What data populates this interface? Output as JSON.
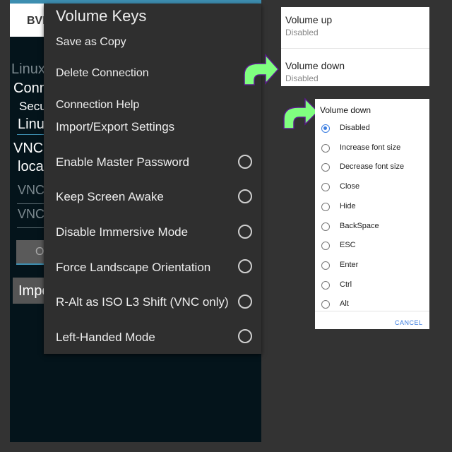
{
  "background_app": {
    "header_label": "BVN",
    "texts": [
      "Linux",
      "Conn",
      "Secu",
      "Linu",
      "VNC",
      "loca",
      "VNC",
      "VNC"
    ],
    "button1": "OI",
    "button2": "Impo"
  },
  "menu": {
    "title": "Volume Keys",
    "items": [
      {
        "label": "Save as Copy"
      },
      {
        "label": "Delete Connection"
      },
      {
        "label": "Connection Help"
      },
      {
        "label": "Import/Export Settings"
      },
      {
        "label": "Enable Master Password",
        "checked": false
      },
      {
        "label": "Keep Screen Awake",
        "checked": false
      },
      {
        "label": "Disable Immersive Mode",
        "checked": false
      },
      {
        "label": "Force Landscape Orientation",
        "checked": false
      },
      {
        "label": "R-Alt as ISO L3 Shift (VNC only)",
        "checked": false
      },
      {
        "label": "Left-Handed Mode",
        "checked": false
      }
    ]
  },
  "volume_keys": [
    {
      "title": "Volume up",
      "value": "Disabled"
    },
    {
      "title": "Volume down",
      "value": "Disabled"
    }
  ],
  "dialog": {
    "title": "Volume down",
    "options": [
      "Disabled",
      "Increase font size",
      "Decrease font size",
      "Close",
      "Hide",
      "BackSpace",
      "ESC",
      "Enter",
      "Ctrl",
      "Alt"
    ],
    "selected": "Disabled",
    "cancel": "CANCEL"
  },
  "colors": {
    "accent": "#3b7de0",
    "arrow": "#80ff80",
    "arrow_outline": "#5a1a8a"
  }
}
